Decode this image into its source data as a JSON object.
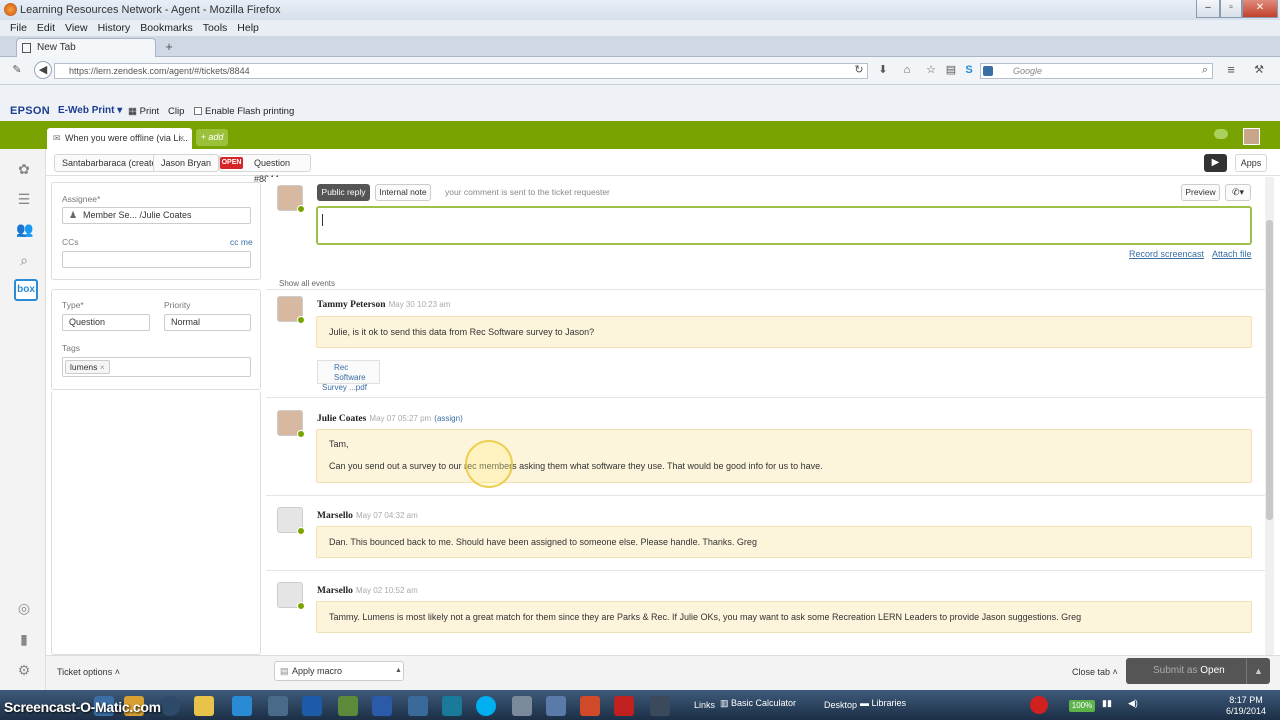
{
  "browser": {
    "window_title": "Learning Resources Network - Agent - Mozilla Firefox",
    "menu": [
      "File",
      "Edit",
      "View",
      "History",
      "Bookmarks",
      "Tools",
      "Help"
    ],
    "tab_title": "New Tab",
    "url": "https://lern.zendesk.com/agent/#/tickets/8844",
    "search_placeholder": "Google"
  },
  "epson": {
    "brand": "EPSON",
    "product": "E-Web Print",
    "print": "Print",
    "clip": "Clip",
    "flash": "Enable Flash printing"
  },
  "zendesk": {
    "tab_label": "When you were offline (via Li...",
    "add_label": "+ add",
    "breadcrumbs": [
      "Santabarbaraca (create)",
      "Jason Bryan"
    ],
    "status_badge": "OPEN",
    "ticket_label": "Question #8844",
    "apps": "Apps"
  },
  "properties": {
    "assignee_label": "Assignee*",
    "assignee_value": "Member Se... /Julie Coates",
    "ccs_label": "CCs",
    "cc_me": "cc me",
    "type_label": "Type*",
    "type_value": "Question",
    "priority_label": "Priority",
    "priority_value": "Normal",
    "tags_label": "Tags",
    "tag": "lumens"
  },
  "composer": {
    "public_reply": "Public reply",
    "internal_note": "Internal note",
    "hint": "your comment is sent to the ticket requester",
    "preview": "Preview",
    "record_screencast": "Record screencast",
    "attach_file": "Attach file",
    "show_all_events": "Show all events"
  },
  "comments": [
    {
      "author": "Tammy Peterson",
      "time": "May 30 10:23 am",
      "body": "Julie, is it ok to send this data from Rec Software survey to Jason?",
      "attachment_line1": "Rec Software",
      "attachment_line2": "Survey ...pdf"
    },
    {
      "author": "Julie Coates",
      "time": "May 07 05:27 pm",
      "assign": "(assign)",
      "body_line1": "Tam,",
      "body_line2": "Can you send out a survey to our rec members asking them what software they use. That would be good info for us to have."
    },
    {
      "author": "Marsello",
      "time": "May 07 04:32 am",
      "body": "Dan. This bounced back to me. Should have been assigned to someone else. Please handle. Thanks. Greg"
    },
    {
      "author": "Marsello",
      "time": "May 02 10:52 am",
      "body": "Tammy. Lumens is most likely not a great match for them since they are Parks & Rec. If Julie OKs, you may want to ask some Recreation LERN Leaders to provide Jason suggestions. Greg"
    }
  ],
  "footer": {
    "ticket_options": "Ticket options",
    "apply_macro": "Apply macro",
    "close_tab": "Close tab",
    "submit_prefix": "Submit as",
    "submit_status": "Open"
  },
  "taskbar": {
    "watermark": "Screencast-O-Matic.com",
    "links": "Links",
    "basic_calculator": "Basic Calculator",
    "desktop": "Desktop",
    "libraries": "Libraries",
    "battery": "100%",
    "time": "8:17 PM",
    "date": "6/19/2014"
  }
}
